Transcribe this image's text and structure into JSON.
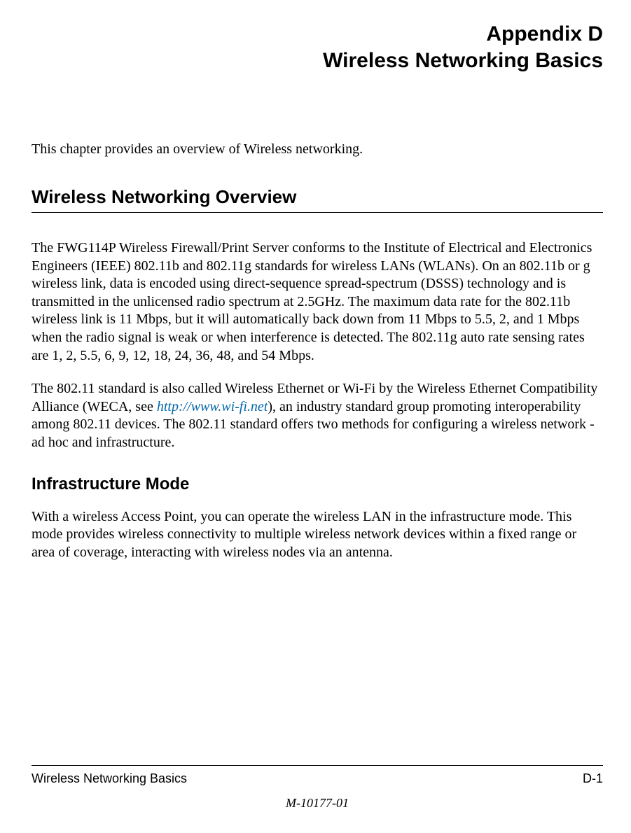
{
  "title": {
    "line1": "Appendix D",
    "line2": "Wireless Networking Basics"
  },
  "intro": "This chapter provides an overview of Wireless networking.",
  "section1": {
    "heading": "Wireless Networking Overview",
    "para1": "The FWG114P Wireless Firewall/Print Server conforms to the Institute of Electrical and Electronics Engineers (IEEE) 802.11b and 802.11g standards for wireless LANs (WLANs). On an 802.11b or g wireless link, data is encoded using direct-sequence spread-spectrum (DSSS) technology and is transmitted in the unlicensed radio spectrum at 2.5GHz. The maximum data rate for the 802.11b wireless link is 11 Mbps, but it will automatically back down from 11 Mbps to 5.5, 2, and 1 Mbps when the radio signal is weak or when interference is detected. The 802.11g auto rate sensing rates are 1, 2, 5.5, 6, 9, 12, 18, 24, 36, 48, and 54 Mbps.",
    "para2_pre": "The 802.11 standard is also called Wireless Ethernet or Wi-Fi by the Wireless Ethernet Compatibility Alliance (WECA, see ",
    "para2_link": "http://www.wi-fi.net",
    "para2_post": "), an industry standard group promoting interoperability among 802.11 devices. The 802.11 standard offers two methods for configuring a wireless network - ad hoc and infrastructure."
  },
  "section2": {
    "heading": "Infrastructure Mode",
    "para1": "With a wireless Access Point, you can operate the wireless LAN in the infrastructure mode. This mode provides wireless connectivity to multiple wireless network devices within a fixed range or area of coverage, interacting with wireless nodes via an antenna."
  },
  "footer": {
    "left": "Wireless Networking Basics",
    "right": "D-1",
    "code": "M-10177-01"
  }
}
